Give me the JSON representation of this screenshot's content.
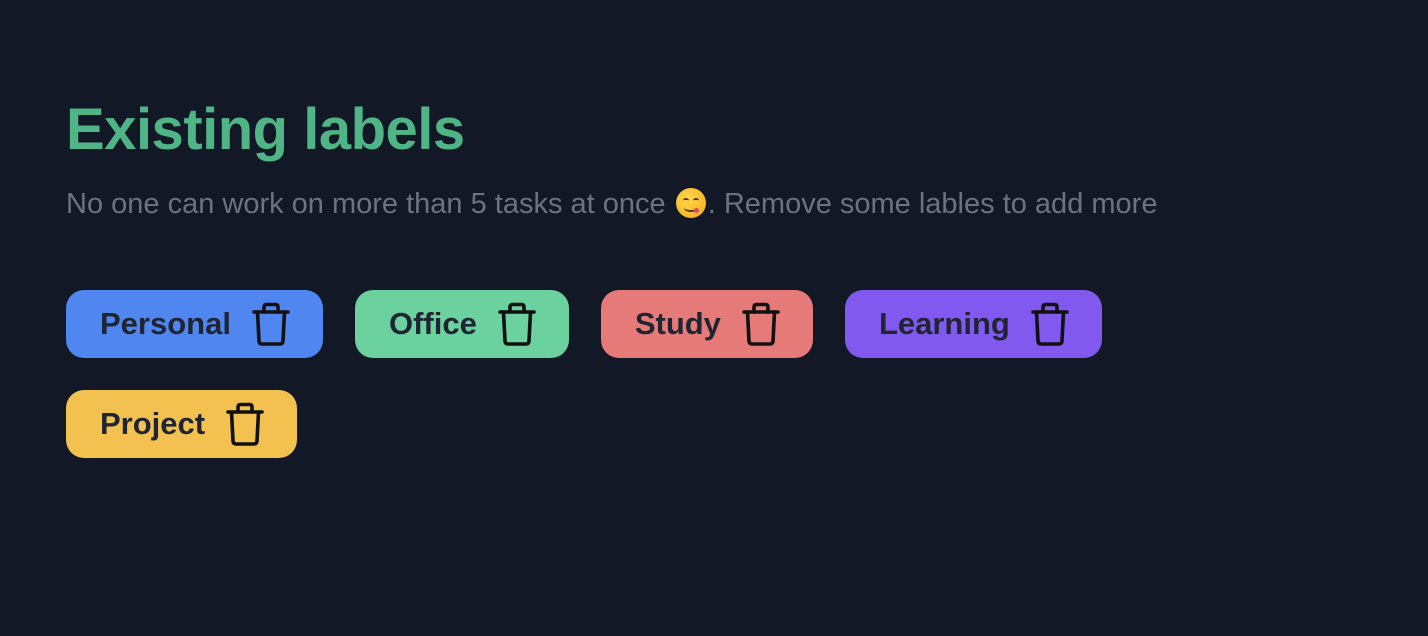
{
  "header": {
    "title": "Existing labels",
    "subtitle_before": "No one can work on more than 5 tasks at once ",
    "subtitle_emoji": "face-savoring-food-emoji",
    "subtitle_after": ". Remove some lables to add more"
  },
  "colors": {
    "background": "#131826",
    "title": "#4fb486",
    "subtitle": "#6b7280",
    "label_text": "#1f2533",
    "icon": "#111111"
  },
  "labels": [
    {
      "name": "Personal",
      "color": "#4f86f0",
      "icon": "trash-icon"
    },
    {
      "name": "Office",
      "color": "#6bd19e",
      "icon": "trash-icon"
    },
    {
      "name": "Study",
      "color": "#e67a78",
      "icon": "trash-icon"
    },
    {
      "name": "Learning",
      "color": "#8159ef",
      "icon": "trash-icon"
    },
    {
      "name": "Project",
      "color": "#f2c14f",
      "icon": "trash-icon"
    }
  ]
}
